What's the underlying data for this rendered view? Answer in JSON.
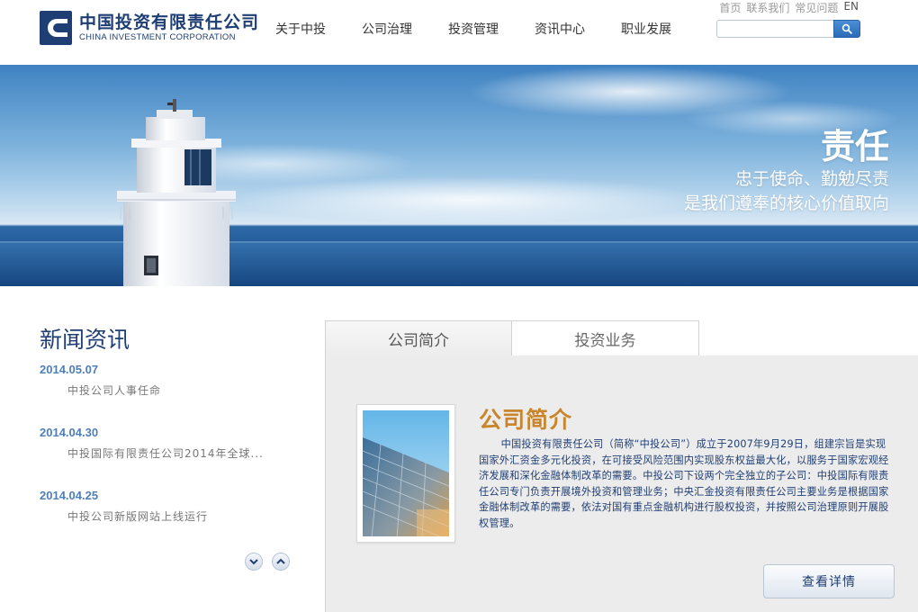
{
  "header": {
    "logo_cn": "中国投资有限责任公司",
    "logo_en": "CHINA INVESTMENT CORPORATION",
    "nav": [
      "关于中投",
      "公司治理",
      "投资管理",
      "资讯中心",
      "职业发展"
    ],
    "toplinks": {
      "home": "首页",
      "contact": "联系我们",
      "faq": "常见问题",
      "lang": "EN"
    },
    "search": {
      "value": "",
      "placeholder": ""
    }
  },
  "banner": {
    "title": "责任",
    "line1": "忠于使命、勤勉尽责",
    "line2": "是我们遵奉的核心价值取向"
  },
  "news": {
    "heading": "新闻资讯",
    "items": [
      {
        "date": "2014.05.07",
        "title": "中投公司人事任命"
      },
      {
        "date": "2014.04.30",
        "title": "中投国际有限责任公司2014年全球..."
      },
      {
        "date": "2014.04.25",
        "title": "中投公司新版网站上线运行"
      }
    ]
  },
  "intro": {
    "tabs": [
      "公司简介",
      "投资业务"
    ],
    "title": "公司简介",
    "text": "中国投资有限责任公司（简称“中投公司”）成立于2007年9月29日，组建宗旨是实现国家外汇资金多元化投资，在可接受风险范围内实现股东权益最大化，以服务于国家宏观经济发展和深化金融体制改革的需要。中投公司下设两个完全独立的子公司：中投国际有限责任公司专门负责开展境外投资和管理业务；中央汇金投资有限责任公司主要业务是根据国家金融体制改革的需要，依法对国有重点金融机构进行股权投资，并按照公司治理原则开展股权管理。",
    "detail_button": "查看详情"
  },
  "colors": {
    "brand": "#1f3e73",
    "accent": "#c9852a",
    "date": "#4f7fb6"
  }
}
